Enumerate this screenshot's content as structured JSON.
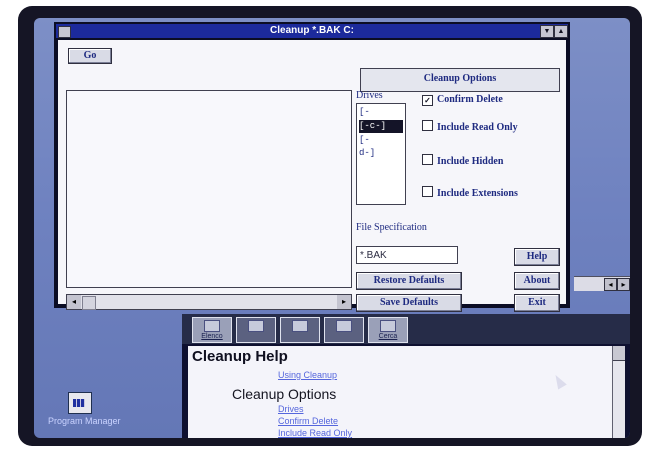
{
  "dialog": {
    "title": "Cleanup *.BAK C:",
    "go_label": "Go",
    "options_header": "Cleanup Options",
    "drives_label": "Drives",
    "drives": [
      "[-a-]",
      "[-c-]",
      "[-d-]"
    ],
    "selected_drive": "[-c-]",
    "options": [
      {
        "label": "Confirm Delete",
        "checked": true
      },
      {
        "label": "Include Read Only",
        "checked": false
      },
      {
        "label": "Include Hidden",
        "checked": false
      },
      {
        "label": "Include Extensions",
        "checked": false
      }
    ],
    "file_spec_label": "File Specification",
    "file_spec_value": "*.BAK",
    "restore_label": "Restore Defaults",
    "save_label": "Save Defaults",
    "help_label": "Help",
    "about_label": "About",
    "exit_label": "Exit"
  },
  "help_window": {
    "toolbar": [
      "Elenco",
      "",
      "",
      "",
      "Cerca"
    ],
    "title": "Cleanup Help",
    "link_using": "Using Cleanup",
    "subtitle": "Cleanup Options",
    "links": [
      "Drives",
      "Confirm Delete",
      "Include Read Only"
    ]
  },
  "desktop": {
    "icon_label": "Program Manager"
  }
}
